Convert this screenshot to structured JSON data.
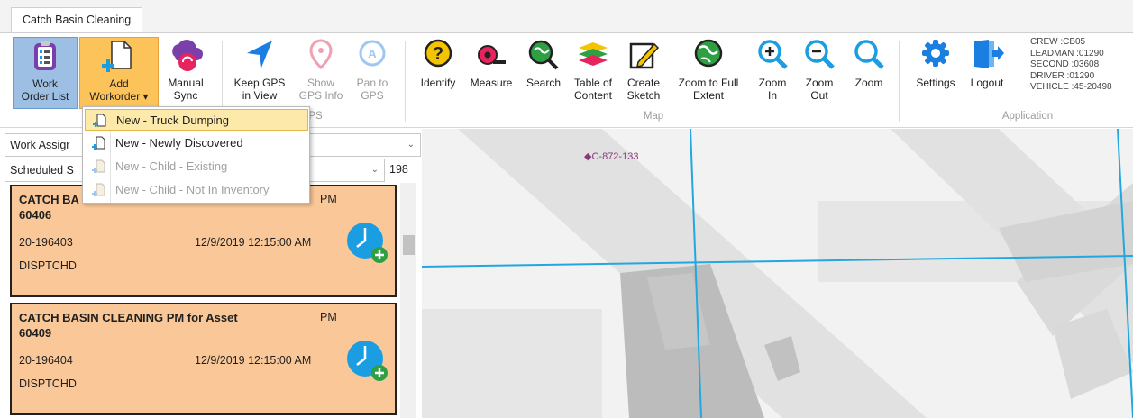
{
  "tab": {
    "label": "Catch Basin Cleaning"
  },
  "ribbon": {
    "buttons": [
      {
        "id": "work_order_list",
        "line1": "Work",
        "line2": "Order List"
      },
      {
        "id": "add_workorder",
        "line1": "Add",
        "line2": "Workorder ▾"
      },
      {
        "id": "manual_sync",
        "line1": "Manual",
        "line2": "Sync"
      },
      {
        "id": "keep_gps",
        "line1": "Keep GPS",
        "line2": "in View"
      },
      {
        "id": "show_gps",
        "line1": "Show",
        "line2": "GPS Info"
      },
      {
        "id": "pan_gps",
        "line1": "Pan to",
        "line2": "GPS"
      },
      {
        "id": "identify",
        "line1": "Identify",
        "line2": ""
      },
      {
        "id": "measure",
        "line1": "Measure",
        "line2": ""
      },
      {
        "id": "search",
        "line1": "Search",
        "line2": ""
      },
      {
        "id": "toc",
        "line1": "Table of",
        "line2": "Content"
      },
      {
        "id": "create_sketch",
        "line1": "Create",
        "line2": "Sketch"
      },
      {
        "id": "zoom_full",
        "line1": "Zoom to Full",
        "line2": "Extent"
      },
      {
        "id": "zoom_in",
        "line1": "Zoom",
        "line2": "In"
      },
      {
        "id": "zoom_out",
        "line1": "Zoom",
        "line2": "Out"
      },
      {
        "id": "zoom",
        "line1": "Zoom",
        "line2": ""
      },
      {
        "id": "settings",
        "line1": "Settings",
        "line2": ""
      },
      {
        "id": "logout",
        "line1": "Logout",
        "line2": ""
      }
    ],
    "groups": {
      "gps": "PS",
      "map": "Map",
      "application": "Application"
    },
    "crew_info": [
      "CREW :CB05",
      "LEADMAN :01290",
      "SECOND :03608",
      "DRIVER :01290",
      "VEHICLE :45-20498"
    ]
  },
  "left_panel": {
    "filter1": "Work Assigr",
    "filter2": "Scheduled S",
    "count": "198",
    "cards": [
      {
        "title_line1": "CATCH BA",
        "title_line2": "60406",
        "pm": "PM",
        "wo_number": "20-196403",
        "datetime": "12/9/2019 12:15:00 AM",
        "status": "DISPTCHD"
      },
      {
        "title_line1": "CATCH BASIN CLEANING PM for Asset",
        "title_line2": "60409",
        "pm": "PM",
        "wo_number": "20-196404",
        "datetime": "12/9/2019 12:15:00 AM",
        "status": "DISPTCHD"
      }
    ]
  },
  "dropdown": {
    "items": [
      {
        "label": "New - Truck Dumping",
        "state": "highlighted"
      },
      {
        "label": "New - Newly Discovered",
        "state": "enabled"
      },
      {
        "label": "New - Child - Existing",
        "state": "disabled"
      },
      {
        "label": "New - Child - Not In Inventory",
        "state": "disabled"
      }
    ]
  },
  "map": {
    "asset_label": "C-872-133"
  },
  "colors": {
    "card_bg": "#fac898",
    "accent_blue": "#1b9de2",
    "map_line": "#22a7e0",
    "hover": "#fbc35a"
  }
}
